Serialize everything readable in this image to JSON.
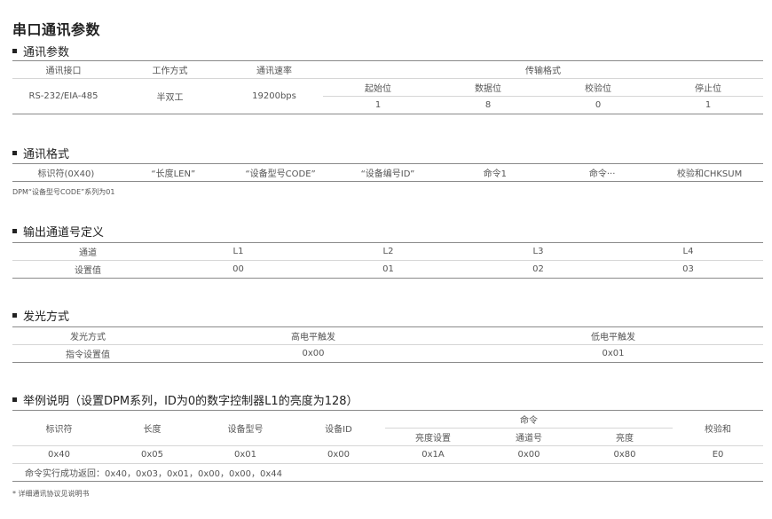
{
  "title": "串口通讯参数",
  "comm_params": {
    "heading": "通讯参数",
    "headers": [
      "通讯接口",
      "工作方式",
      "通讯速率",
      "传输格式"
    ],
    "format_headers": [
      "起始位",
      "数据位",
      "校验位",
      "停止位"
    ],
    "values": [
      "RS-232/EIA-485",
      "半双工",
      "19200bps"
    ],
    "format_values": [
      "1",
      "8",
      "0",
      "1"
    ]
  },
  "comm_format": {
    "heading": "通讯格式",
    "fields": [
      "标识符(0X40)",
      "“长度LEN”",
      "“设备型号CODE”",
      "“设备编号ID”",
      "命令1",
      "命令···",
      "校验和CHKSUM"
    ],
    "note": "DPM“设备型号CODE”系列为01"
  },
  "output_channels": {
    "heading": "输出通道号定义",
    "row_labels": [
      "通道",
      "设置值"
    ],
    "channels": [
      "L1",
      "L2",
      "L3",
      "L4"
    ],
    "values": [
      "00",
      "01",
      "02",
      "03"
    ]
  },
  "light_mode": {
    "heading": "发光方式",
    "row_labels": [
      "发光方式",
      "指令设置值"
    ],
    "modes": [
      "高电平触发",
      "低电平触发"
    ],
    "values": [
      "0x00",
      "0x01"
    ]
  },
  "example": {
    "heading": "举例说明（设置DPM系列，ID为0的数字控制器L1的亮度为128）",
    "headers": [
      "标识符",
      "长度",
      "设备型号",
      "设备ID",
      "命令",
      "校验和"
    ],
    "command_subheaders": [
      "亮度设置",
      "通道号",
      "亮度"
    ],
    "values": [
      "0x40",
      "0x05",
      "0x01",
      "0x00",
      "0x1A",
      "0x00",
      "0x80",
      "E0"
    ],
    "success_return": "命令实行成功返回：0x40，0x03，0x01，0x00，0x00，0x44"
  },
  "footnote": "* 详细通讯协议见说明书"
}
